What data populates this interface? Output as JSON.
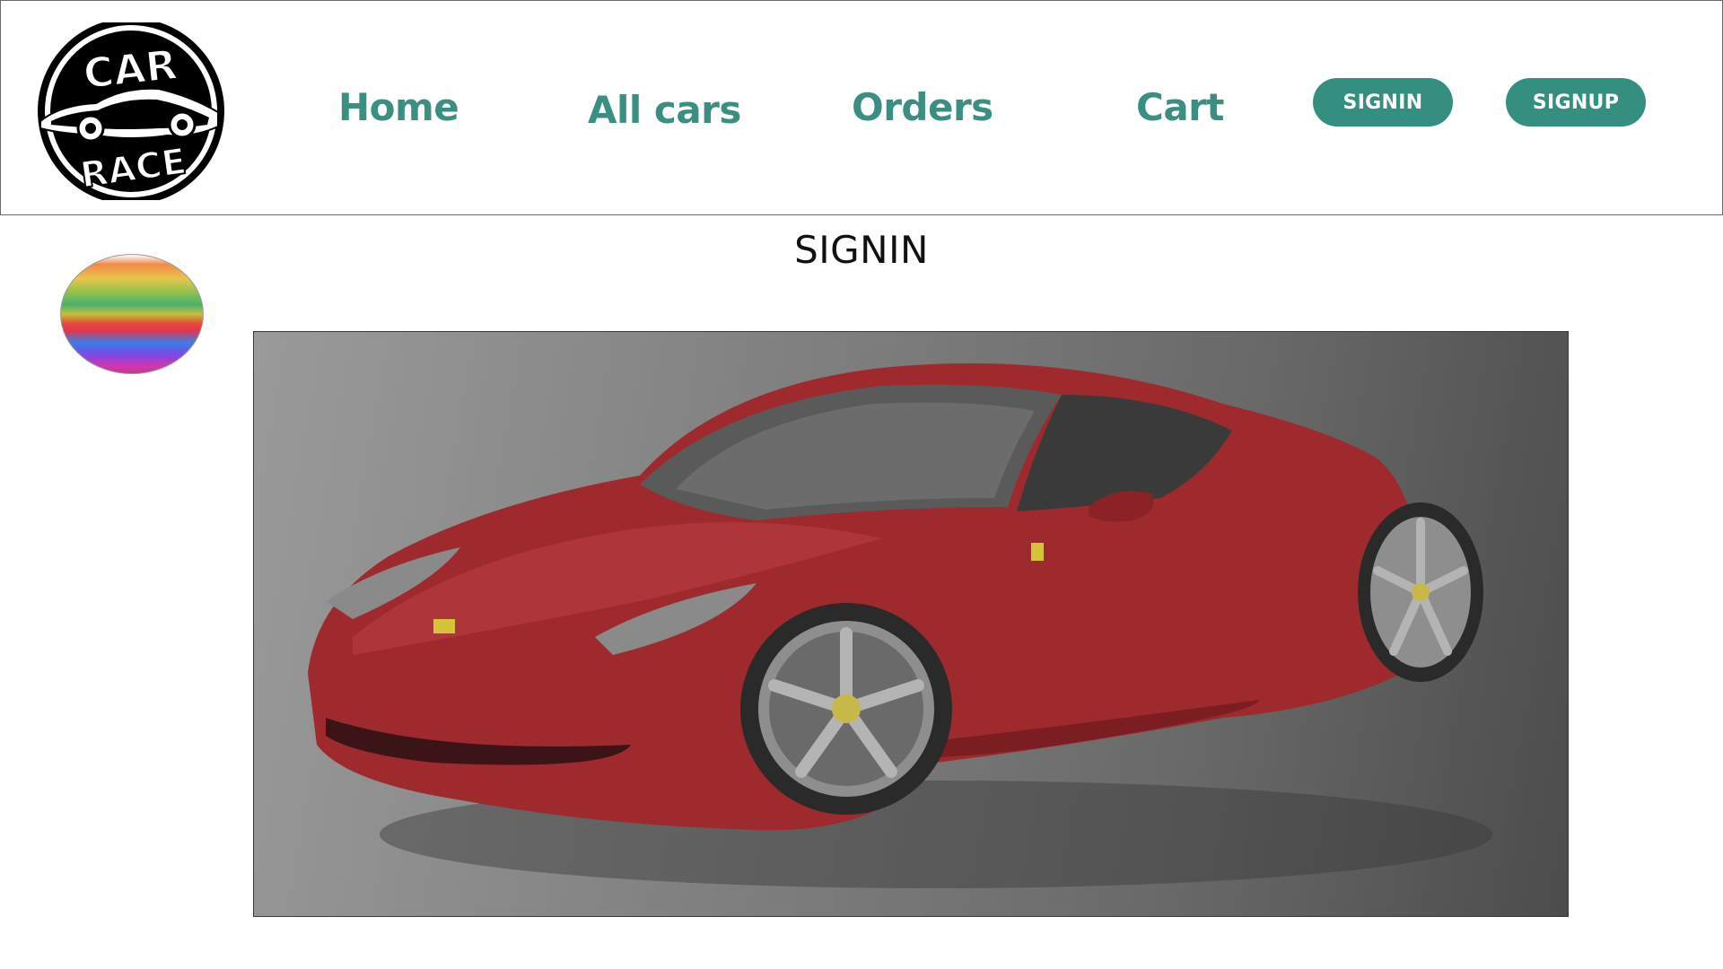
{
  "logo": {
    "text_top": "CAR",
    "text_bottom": "RACE"
  },
  "nav": {
    "home": "Home",
    "all_cars": "All cars",
    "orders": "Orders",
    "cart": "Cart",
    "signin_button": "SIGNIN",
    "signup_button": "SIGNUP"
  },
  "main": {
    "title": "SIGNIN"
  },
  "colors": {
    "accent": "#358f80",
    "nav_text": "#3a8f82",
    "car_body": "#9e2a2e"
  },
  "icons": {
    "logo": "car-race-logo",
    "avatar": "rainbow-avatar-icon",
    "hero": "red-sports-car-image"
  }
}
